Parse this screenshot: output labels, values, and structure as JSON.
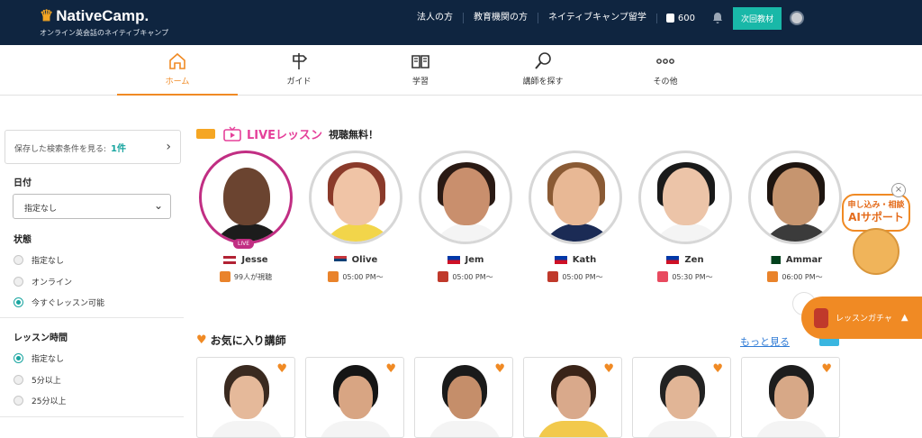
{
  "header": {
    "logo_text": "NativeCamp.",
    "logo_sub": "オンライン英会話のネイティブキャンプ",
    "links": [
      "法人の方",
      "教育機関の方",
      "ネイティブキャンプ留学"
    ],
    "coins": "600",
    "next_button": "次回教材"
  },
  "nav": {
    "items": [
      {
        "label": "ホーム",
        "icon": "home-icon",
        "active": true
      },
      {
        "label": "ガイド",
        "icon": "signpost-icon"
      },
      {
        "label": "学習",
        "icon": "book-icon"
      },
      {
        "label": "講師を探す",
        "icon": "search-icon"
      },
      {
        "label": "その他",
        "icon": "more-icon"
      }
    ]
  },
  "sidebar": {
    "saved_label": "保存した検索条件を見る:",
    "saved_count": "1件",
    "date_label": "日付",
    "date_value": "指定なし",
    "status_label": "状態",
    "status_options": [
      "指定なし",
      "オンライン",
      "今すぐレッスン可能"
    ],
    "status_selected": 2,
    "lesson_time_label": "レッスン時間",
    "lesson_time_options": [
      "指定なし",
      "5分以上",
      "25分以上"
    ],
    "lesson_time_selected": 0
  },
  "live": {
    "title": "LIVEレッスン",
    "free_label": "視聴無料！",
    "live_badge": "LIVE",
    "teachers": [
      {
        "name": "Jesse",
        "meta": "99人が視聴",
        "flag": "US"
      },
      {
        "name": "Olive",
        "meta": "05:00 PM〜",
        "flag": "RS"
      },
      {
        "name": "Jem",
        "meta": "05:00 PM〜",
        "flag": "PH"
      },
      {
        "name": "Kath",
        "meta": "05:00 PM〜",
        "flag": "PH"
      },
      {
        "name": "Zen",
        "meta": "05:30 PM〜",
        "flag": "PH"
      },
      {
        "name": "Ammar",
        "meta": "06:00 PM〜",
        "flag": "PK"
      }
    ]
  },
  "favorites": {
    "title": "お気に入り講師",
    "more_link": "もっと見る"
  },
  "ai_support": {
    "line1": "申し込み・相談",
    "line2": "AIサポート"
  },
  "gacha": {
    "label": "レッスンガチャ"
  },
  "colors": {
    "header_bg": "#0f2540",
    "accent_orange": "#f08a24",
    "teal": "#19b8a8",
    "live_pink": "#e5409a"
  }
}
